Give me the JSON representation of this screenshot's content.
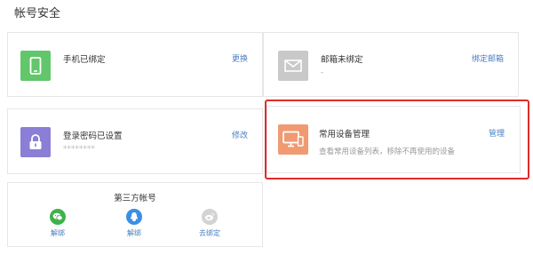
{
  "page": {
    "title": "帐号安全"
  },
  "phone": {
    "title": "手机已绑定",
    "action": "更换",
    "color": "#62c66b"
  },
  "email": {
    "title": "邮箱未绑定",
    "sub": "-",
    "action": "绑定邮箱",
    "color": "#c9c9c9"
  },
  "password": {
    "title": "登录密码已设置",
    "masked": "********",
    "action": "修改",
    "color": "#8b7ed6"
  },
  "device": {
    "title": "常用设备管理",
    "description": "查看常用设备列表，移除不再使用的设备",
    "action": "管理",
    "color": "#ef9a72"
  },
  "third_party": {
    "title": "第三方帐号",
    "accounts": [
      {
        "icon": "wechat-icon",
        "action": "解绑",
        "color": "#3fb24a"
      },
      {
        "icon": "qq-icon",
        "action": "解绑",
        "color": "#3a8ee6"
      },
      {
        "icon": "weibo-icon",
        "action": "去绑定",
        "color": "#d3d3d3"
      }
    ]
  },
  "colors": {
    "link": "#4a7fc1",
    "highlight": "#e02b27",
    "border": "#e6e6e6"
  }
}
